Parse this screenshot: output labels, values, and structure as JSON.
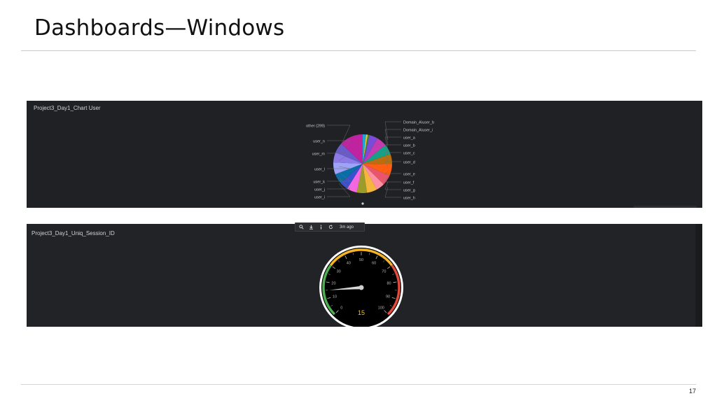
{
  "slide": {
    "title": "Dashboards—Windows",
    "page_number": "17"
  },
  "pie_panel": {
    "title": "Project3_Day1_Chart User",
    "left_labels": [
      "other (299)",
      "user_n",
      "user_m",
      "user_l",
      "user_k",
      "user_j",
      "user_i"
    ],
    "right_labels": [
      "Domain_A\\user_b",
      "Domain_A\\user_i",
      "user_a",
      "user_b",
      "user_c",
      "user_d",
      "user_e",
      "user_f",
      "user_g",
      "user_h"
    ]
  },
  "gauge_panel": {
    "title": "Project3_Day1_Uniq_Session_ID",
    "toolbar": {
      "icons": [
        "search-icon",
        "download-icon",
        "info-icon",
        "refresh-icon"
      ],
      "last_updated": "3m ago"
    },
    "ticks": [
      "0",
      "10",
      "20",
      "30",
      "40",
      "50",
      "60",
      "70",
      "80",
      "90",
      "100"
    ],
    "value": 15,
    "value_label": "15",
    "range": [
      0,
      100
    ],
    "band_colors": [
      "#4caf50",
      "#f4b324",
      "#e04b3d"
    ]
  }
}
